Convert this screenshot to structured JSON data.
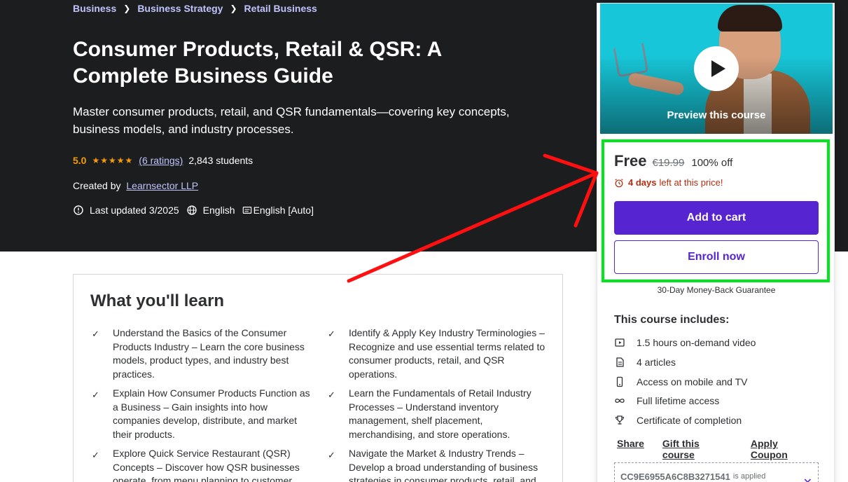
{
  "breadcrumb": [
    "Business",
    "Business Strategy",
    "Retail Business"
  ],
  "course": {
    "title": "Consumer Products, Retail & QSR: A Complete Business Guide",
    "subtitle": "Master consumer products, retail, and QSR fundamentals—covering key concepts, business models, and industry processes.",
    "rating": "5.0",
    "stars": 5,
    "rating_count": "(6 ratings)",
    "students": "2,843 students",
    "created_by_label": "Created by",
    "author": "Learnsector LLP",
    "last_updated": "Last updated 3/2025",
    "language": "English",
    "captions": "English [Auto]"
  },
  "learn": {
    "title": "What you'll learn",
    "items": [
      "Understand the Basics of the Consumer Products Industry – Learn the core business models, product types, and industry best practices.",
      "Identify & Apply Key Industry Terminologies – Recognize and use essential terms related to consumer products, retail, and QSR operations.",
      "Explain How Consumer Products Function as a Business – Gain insights into how companies develop, distribute, and market their products.",
      "Learn the Fundamentals of Retail Industry Processes – Understand inventory management, shelf placement, merchandising, and store operations.",
      "Explore Quick Service Restaurant (QSR) Concepts – Discover how QSR businesses operate, from menu planning to customer",
      "Navigate the Market & Industry Trends – Develop a broad understanding of business strategies in consumer products, retail, and"
    ]
  },
  "sidebar": {
    "preview_label": "Preview this course",
    "price": "Free",
    "original_price": "€19.99",
    "discount": "100% off",
    "timer_bold": "4 days",
    "timer_rest": "left at this price!",
    "add_to_cart": "Add to cart",
    "enroll_now": "Enroll now",
    "guarantee": "30-Day Money-Back Guarantee",
    "includes_title": "This course includes:",
    "includes": [
      {
        "icon": "video-icon",
        "label": "1.5 hours on-demand video"
      },
      {
        "icon": "article-icon",
        "label": "4 articles"
      },
      {
        "icon": "mobile-icon",
        "label": "Access on mobile and TV"
      },
      {
        "icon": "infinity-icon",
        "label": "Full lifetime access"
      },
      {
        "icon": "trophy-icon",
        "label": "Certificate of completion"
      }
    ],
    "share": "Share",
    "gift": "Gift this course",
    "apply_coupon": "Apply Coupon",
    "coupon_code": "CC9E6955A6C8B3271541",
    "coupon_note": "is applied"
  },
  "colors": {
    "hero_bg": "#1c1d1f",
    "accent_purple": "#5624d0",
    "star_orange": "#f69c08",
    "link_lavender": "#c0c4fc",
    "highlight_green": "#00e81b",
    "arrow_red": "#ff1010",
    "timer_red": "#b32d0f"
  }
}
